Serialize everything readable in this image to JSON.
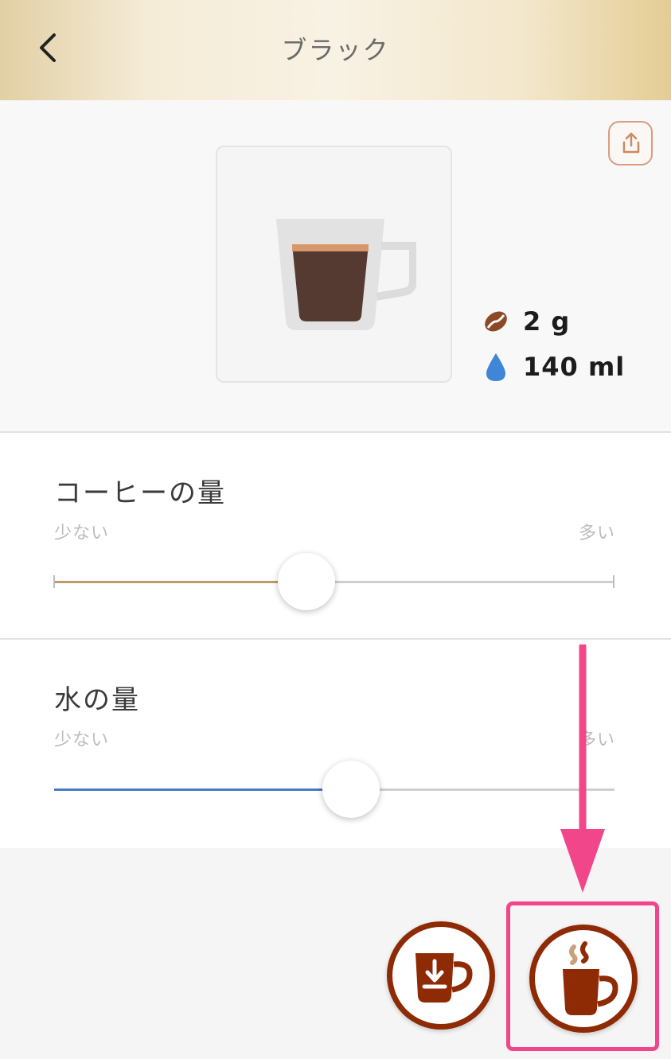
{
  "header": {
    "title": "ブラック",
    "back_icon": "chevron-left-icon"
  },
  "drink": {
    "share_icon": "share-icon",
    "cup_icon": "coffee-cup-icon",
    "coffee_amount": "2 g",
    "water_amount": "140 ml",
    "coffee_icon": "coffee-bean-icon",
    "water_icon": "water-drop-icon"
  },
  "coffee_slider": {
    "title": "コーヒーの量",
    "min_label": "少ない",
    "max_label": "多い",
    "level": 0.45,
    "fill_color": "#bf9b6c"
  },
  "water_slider": {
    "title": "水の量",
    "min_label": "少ない",
    "max_label": "多い",
    "level": 0.53,
    "fill_color": "#4a79c2"
  },
  "actions": {
    "save_icon": "cup-download-icon",
    "brew_icon": "steaming-cup-icon",
    "accent_color": "#8e2a04",
    "highlight_color": "#f2468a"
  }
}
